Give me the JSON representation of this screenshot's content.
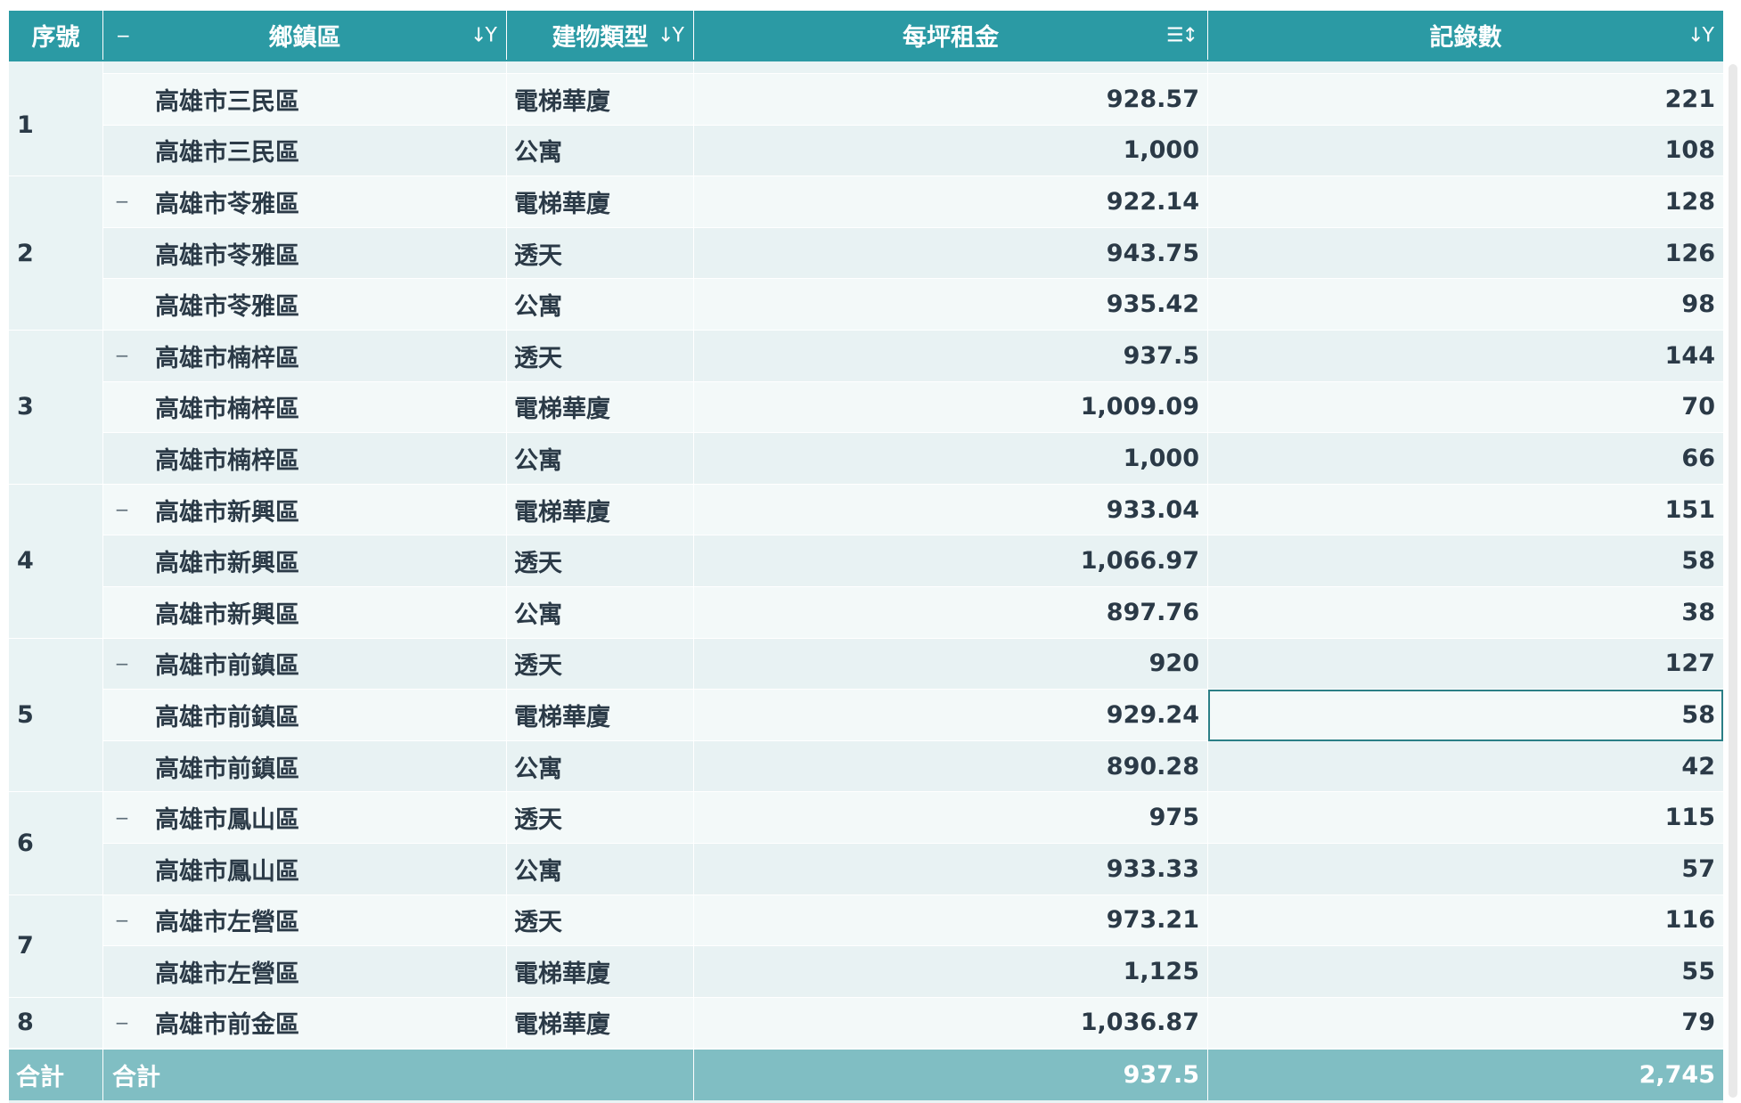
{
  "header": {
    "seq_label": "序號",
    "district_label": "鄉鎮區",
    "type_label": "建物類型",
    "rent_label": "每坪租金",
    "count_label": "記錄數",
    "collapse_symbol": "−",
    "sort_filter_symbol": "↓Y",
    "sort_symbol": "☰↕"
  },
  "groups": [
    {
      "seq": "1",
      "rows": [
        {
          "district": "高雄市三民區",
          "type": "電梯華廈",
          "rent": "928.57",
          "count": "221",
          "toggle": false
        },
        {
          "district": "高雄市三民區",
          "type": "公寓",
          "rent": "1,000",
          "count": "108",
          "toggle": false
        }
      ]
    },
    {
      "seq": "2",
      "rows": [
        {
          "district": "高雄市苓雅區",
          "type": "電梯華廈",
          "rent": "922.14",
          "count": "128",
          "toggle": true
        },
        {
          "district": "高雄市苓雅區",
          "type": "透天",
          "rent": "943.75",
          "count": "126",
          "toggle": false
        },
        {
          "district": "高雄市苓雅區",
          "type": "公寓",
          "rent": "935.42",
          "count": "98",
          "toggle": false
        }
      ]
    },
    {
      "seq": "3",
      "rows": [
        {
          "district": "高雄市楠梓區",
          "type": "透天",
          "rent": "937.5",
          "count": "144",
          "toggle": true
        },
        {
          "district": "高雄市楠梓區",
          "type": "電梯華廈",
          "rent": "1,009.09",
          "count": "70",
          "toggle": false
        },
        {
          "district": "高雄市楠梓區",
          "type": "公寓",
          "rent": "1,000",
          "count": "66",
          "toggle": false
        }
      ]
    },
    {
      "seq": "4",
      "rows": [
        {
          "district": "高雄市新興區",
          "type": "電梯華廈",
          "rent": "933.04",
          "count": "151",
          "toggle": true
        },
        {
          "district": "高雄市新興區",
          "type": "透天",
          "rent": "1,066.97",
          "count": "58",
          "toggle": false
        },
        {
          "district": "高雄市新興區",
          "type": "公寓",
          "rent": "897.76",
          "count": "38",
          "toggle": false
        }
      ]
    },
    {
      "seq": "5",
      "rows": [
        {
          "district": "高雄市前鎮區",
          "type": "透天",
          "rent": "920",
          "count": "127",
          "toggle": true
        },
        {
          "district": "高雄市前鎮區",
          "type": "電梯華廈",
          "rent": "929.24",
          "count": "58",
          "toggle": false,
          "selected": true
        },
        {
          "district": "高雄市前鎮區",
          "type": "公寓",
          "rent": "890.28",
          "count": "42",
          "toggle": false
        }
      ]
    },
    {
      "seq": "6",
      "rows": [
        {
          "district": "高雄市鳳山區",
          "type": "透天",
          "rent": "975",
          "count": "115",
          "toggle": true
        },
        {
          "district": "高雄市鳳山區",
          "type": "公寓",
          "rent": "933.33",
          "count": "57",
          "toggle": false
        }
      ]
    },
    {
      "seq": "7",
      "rows": [
        {
          "district": "高雄市左營區",
          "type": "透天",
          "rent": "973.21",
          "count": "116",
          "toggle": true
        },
        {
          "district": "高雄市左營區",
          "type": "電梯華廈",
          "rent": "1,125",
          "count": "55",
          "toggle": false
        }
      ]
    },
    {
      "seq": "8",
      "rows": [
        {
          "district": "高雄市前金區",
          "type": "電梯華廈",
          "rent": "1,036.87",
          "count": "79",
          "toggle": true
        }
      ]
    }
  ],
  "total": {
    "seq_label": "合計",
    "label": "合計",
    "rent": "937.5",
    "count": "2,745"
  },
  "colors": {
    "header_bg": "#2b9aa4",
    "total_bg": "#80bec3",
    "row_odd": "#f3f9f9",
    "row_even": "#e8f2f3",
    "selected_border": "#2b7f86"
  }
}
